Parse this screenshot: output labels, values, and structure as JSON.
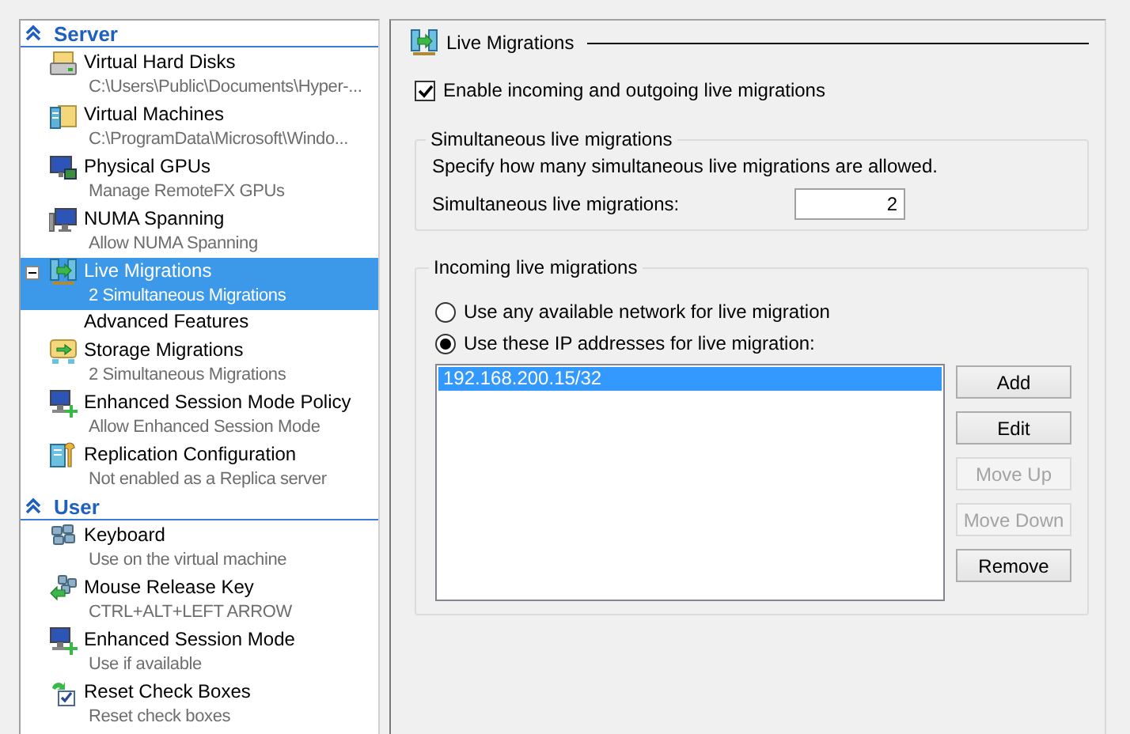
{
  "sidebar": {
    "sections": [
      {
        "title": "Server",
        "expanded": true,
        "items": [
          {
            "title": "Virtual Hard Disks",
            "subtitle": "C:\\Users\\Public\\Documents\\Hyper-...",
            "selected": false
          },
          {
            "title": "Virtual Machines",
            "subtitle": "C:\\ProgramData\\Microsoft\\Windo...",
            "selected": false
          },
          {
            "title": "Physical GPUs",
            "subtitle": "Manage RemoteFX GPUs",
            "selected": false
          },
          {
            "title": "NUMA Spanning",
            "subtitle": "Allow NUMA Spanning",
            "selected": false
          },
          {
            "title": "Live Migrations",
            "subtitle": "2 Simultaneous Migrations",
            "selected": true,
            "expanded": true,
            "children": [
              {
                "title": "Advanced Features",
                "selected": false
              }
            ]
          },
          {
            "title": "Storage Migrations",
            "subtitle": "2 Simultaneous Migrations",
            "selected": false
          },
          {
            "title": "Enhanced Session Mode Policy",
            "subtitle": "Allow Enhanced Session Mode",
            "selected": false
          },
          {
            "title": "Replication Configuration",
            "subtitle": "Not enabled as a Replica server",
            "selected": false
          }
        ]
      },
      {
        "title": "User",
        "expanded": true,
        "items": [
          {
            "title": "Keyboard",
            "subtitle": "Use on the virtual machine",
            "selected": false
          },
          {
            "title": "Mouse Release Key",
            "subtitle": "CTRL+ALT+LEFT ARROW",
            "selected": false
          },
          {
            "title": "Enhanced Session Mode",
            "subtitle": "Use if available",
            "selected": false
          },
          {
            "title": "Reset Check Boxes",
            "subtitle": "Reset check boxes",
            "selected": false
          }
        ]
      }
    ]
  },
  "panel": {
    "title": "Live Migrations",
    "enable_checkbox": {
      "label": "Enable incoming and outgoing live migrations",
      "checked": true
    },
    "simultaneous_group": {
      "title": "Simultaneous live migrations",
      "description": "Specify how many simultaneous live migrations are allowed.",
      "field_label": "Simultaneous live migrations:",
      "value": "2"
    },
    "incoming_group": {
      "title": "Incoming live migrations",
      "options": [
        {
          "label": "Use any available network for live migration",
          "selected": false
        },
        {
          "label": "Use these IP addresses for live migration:",
          "selected": true
        }
      ],
      "addresses": [
        {
          "text": "192.168.200.15/32",
          "selected": true
        }
      ],
      "buttons": [
        {
          "label": "Add",
          "disabled": false
        },
        {
          "label": "Edit",
          "disabled": false
        },
        {
          "label": "Move Up",
          "disabled": true
        },
        {
          "label": "Move Down",
          "disabled": true
        },
        {
          "label": "Remove",
          "disabled": false
        }
      ]
    }
  }
}
